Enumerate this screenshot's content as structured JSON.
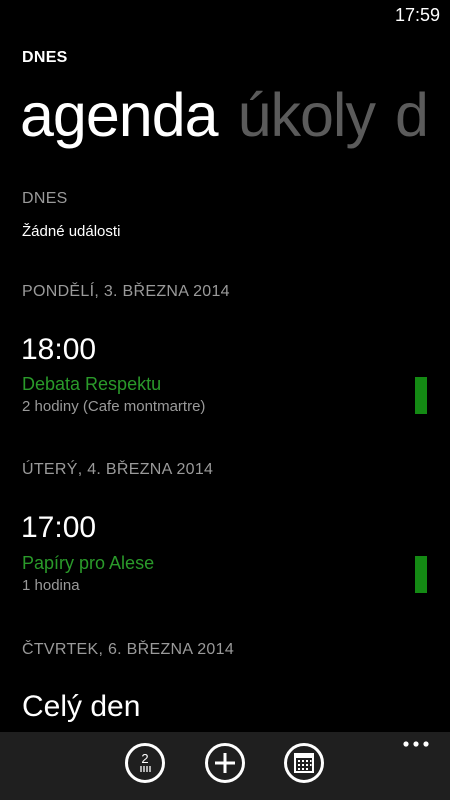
{
  "status_bar": {
    "time": "17:59"
  },
  "app": {
    "title": "DNES"
  },
  "pivot": [
    {
      "label": "agenda",
      "active": true
    },
    {
      "label": "úkoly",
      "active": false
    },
    {
      "label": "d",
      "active": false
    }
  ],
  "sections": {
    "today": {
      "header": "DNES",
      "empty_text": "Žádné události"
    },
    "day1": {
      "header": "PONDĚLÍ, 3. BŘEZNA 2014",
      "event": {
        "time": "18:00",
        "title": "Debata Respektu",
        "details": "2 hodiny (Cafe montmartre)"
      }
    },
    "day2": {
      "header": "ÚTERÝ, 4. BŘEZNA 2014",
      "event": {
        "time": "17:00",
        "title": "Papíry pro Alese",
        "details": "1 hodina"
      }
    },
    "day3": {
      "header": "ČTVRTEK, 6. BŘEZNA 2014",
      "event": {
        "time": "Celý den"
      }
    }
  },
  "app_bar": {
    "buttons": [
      {
        "icon": "day-view-icon",
        "label": "2"
      },
      {
        "icon": "add-icon"
      },
      {
        "icon": "calendar-icon"
      }
    ],
    "more": "more-options-icon"
  },
  "colors": {
    "accent": "#148a14",
    "event_title": "#2a9a2a",
    "secondary_text": "#9a9a9a",
    "inactive_pivot": "#5b5b5b",
    "app_bar": "#1f1f1f"
  }
}
